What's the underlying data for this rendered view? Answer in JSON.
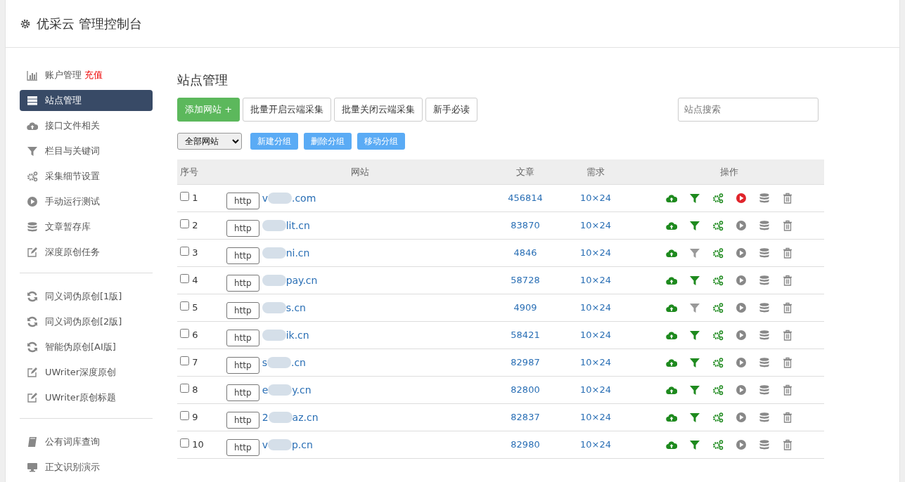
{
  "header": {
    "title": "优采云 管理控制台"
  },
  "sidebar": {
    "groups": [
      {
        "items": [
          {
            "kind": "chart",
            "label": "账户管理",
            "extra": "充值",
            "selected": false
          },
          {
            "kind": "server",
            "label": "站点管理",
            "selected": true
          },
          {
            "kind": "cloud",
            "label": "接口文件相关",
            "selected": false
          },
          {
            "kind": "filter",
            "label": "栏目与关键词",
            "selected": false
          },
          {
            "kind": "gears",
            "label": "采集细节设置",
            "selected": false
          },
          {
            "kind": "play",
            "label": "手动运行测试",
            "selected": false
          },
          {
            "kind": "database",
            "label": "文章暂存库",
            "selected": false
          },
          {
            "kind": "edit",
            "label": "深度原创任务",
            "selected": false
          }
        ]
      },
      {
        "items": [
          {
            "kind": "refresh",
            "label": "同义词伪原创[1版]",
            "selected": false
          },
          {
            "kind": "refresh",
            "label": "同义词伪原创[2版]",
            "selected": false
          },
          {
            "kind": "refresh",
            "label": "智能伪原创[AI版]",
            "selected": false
          },
          {
            "kind": "edit",
            "label": "UWriter深度原创",
            "selected": false
          },
          {
            "kind": "edit",
            "label": "UWriter原创标题",
            "selected": false
          }
        ]
      },
      {
        "items": [
          {
            "kind": "book",
            "label": "公有词库查询",
            "selected": false
          },
          {
            "kind": "monitor",
            "label": "正文识别演示",
            "selected": false
          }
        ]
      }
    ]
  },
  "main": {
    "title": "站点管理",
    "toolbar": [
      {
        "kind": "primary",
        "label": "添加网站 +"
      },
      {
        "kind": "default",
        "label": "批量开启云端采集"
      },
      {
        "kind": "default",
        "label": "批量关闭云端采集"
      },
      {
        "kind": "default",
        "label": "新手必读"
      }
    ],
    "search": {
      "placeholder": "站点搜索"
    },
    "group_select": {
      "value": "全部网站"
    },
    "group_buttons": [
      "新建分组",
      "删除分组",
      "移动分组"
    ],
    "table": {
      "columns": [
        "序号",
        "网站",
        "文章",
        "需求",
        "操作"
      ],
      "rows": [
        {
          "index": "1",
          "checked": false,
          "protocol": "http",
          "domain_start": "v",
          "domain_end": ".com",
          "articles": "456814",
          "demand": "10×24",
          "filter_on": true,
          "running": true
        },
        {
          "index": "2",
          "checked": false,
          "protocol": "http",
          "domain_start": "",
          "domain_end": "lit.cn",
          "articles": "83870",
          "demand": "10×24",
          "filter_on": true,
          "running": false
        },
        {
          "index": "3",
          "checked": false,
          "protocol": "http",
          "domain_start": "",
          "domain_end": "ni.cn",
          "articles": "4846",
          "demand": "10×24",
          "filter_on": false,
          "running": false
        },
        {
          "index": "4",
          "checked": false,
          "protocol": "http",
          "domain_start": "",
          "domain_end": "pay.cn",
          "articles": "58728",
          "demand": "10×24",
          "filter_on": true,
          "running": false
        },
        {
          "index": "5",
          "checked": false,
          "protocol": "http",
          "domain_start": "",
          "domain_end": "s.cn",
          "articles": "4909",
          "demand": "10×24",
          "filter_on": false,
          "running": false
        },
        {
          "index": "6",
          "checked": false,
          "protocol": "http",
          "domain_start": "",
          "domain_end": "ik.cn",
          "articles": "58421",
          "demand": "10×24",
          "filter_on": true,
          "running": false
        },
        {
          "index": "7",
          "checked": false,
          "protocol": "http",
          "domain_start": "s",
          "domain_end": ".cn",
          "articles": "82987",
          "demand": "10×24",
          "filter_on": true,
          "running": false
        },
        {
          "index": "8",
          "checked": false,
          "protocol": "http",
          "domain_start": "e",
          "domain_end": "y.cn",
          "articles": "82800",
          "demand": "10×24",
          "filter_on": true,
          "running": false
        },
        {
          "index": "9",
          "checked": false,
          "protocol": "http",
          "domain_start": "2",
          "domain_end": "az.cn",
          "articles": "82837",
          "demand": "10×24",
          "filter_on": true,
          "running": false
        },
        {
          "index": "10",
          "checked": false,
          "protocol": "http",
          "domain_start": "v",
          "domain_end": "p.cn",
          "articles": "82980",
          "demand": "10×24",
          "filter_on": true,
          "running": false
        }
      ]
    }
  }
}
